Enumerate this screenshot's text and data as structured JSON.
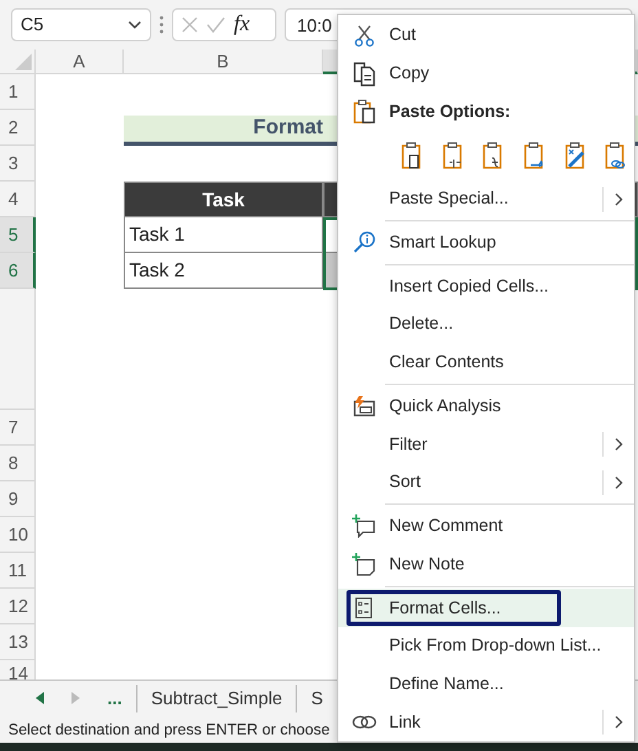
{
  "formula_bar": {
    "name_box": "C5",
    "function_label": "fx",
    "formula": "10:0"
  },
  "columns": [
    {
      "label": "A",
      "selected": false
    },
    {
      "label": "B",
      "selected": false
    },
    {
      "selected": true
    }
  ],
  "rows_upper": [
    {
      "number": "1",
      "selected": false
    },
    {
      "number": "2",
      "selected": false,
      "title": "Format"
    },
    {
      "number": "3",
      "selected": false
    },
    {
      "number": "4",
      "selected": false,
      "header": "Task"
    },
    {
      "number": "5",
      "selected": true,
      "cell_b": "Task 1"
    },
    {
      "number": "6",
      "selected": true,
      "cell_b": "Task 2"
    }
  ],
  "rows_lower": [
    {
      "number": "7"
    },
    {
      "number": "8"
    },
    {
      "number": "9"
    },
    {
      "number": "10"
    },
    {
      "number": "11"
    },
    {
      "number": "12"
    },
    {
      "number": "13"
    },
    {
      "number": "14"
    }
  ],
  "sheet_tabs": {
    "more": "...",
    "tabs": [
      {
        "label": "Subtract_Simple",
        "selected": false
      },
      {
        "label": "S",
        "selected": false
      }
    ]
  },
  "status_bar": "Select destination and press ENTER or choose",
  "menu": [
    {
      "kind": "item",
      "label": "Cut",
      "submenu": false,
      "selected": false
    },
    {
      "kind": "item",
      "label": "Copy",
      "submenu": false,
      "selected": false
    },
    {
      "kind": "heading",
      "label": "Paste Options:"
    },
    {
      "kind": "paste-icons"
    },
    {
      "kind": "item",
      "label": "Paste Special...",
      "submenu": true,
      "selected": false
    },
    {
      "kind": "separator"
    },
    {
      "kind": "item",
      "label": "Smart Lookup",
      "submenu": false,
      "selected": false
    },
    {
      "kind": "separator"
    },
    {
      "kind": "item",
      "label": "Insert Copied Cells...",
      "submenu": false,
      "selected": false
    },
    {
      "kind": "item",
      "label": "Delete...",
      "submenu": false,
      "selected": false
    },
    {
      "kind": "item",
      "label": "Clear Contents",
      "submenu": false,
      "selected": false
    },
    {
      "kind": "separator"
    },
    {
      "kind": "item",
      "label": "Quick Analysis",
      "submenu": false,
      "selected": false
    },
    {
      "kind": "item",
      "label": "Filter",
      "submenu": true,
      "selected": false
    },
    {
      "kind": "item",
      "label": "Sort",
      "submenu": true,
      "selected": false
    },
    {
      "kind": "separator"
    },
    {
      "kind": "item",
      "label": "New Comment",
      "submenu": false,
      "selected": false
    },
    {
      "kind": "item",
      "label": "New Note",
      "submenu": false,
      "selected": false
    },
    {
      "kind": "separator"
    },
    {
      "kind": "item",
      "label": "Format Cells...",
      "submenu": false,
      "selected": true
    },
    {
      "kind": "item",
      "label": "Pick From Drop-down List...",
      "submenu": false,
      "selected": false
    },
    {
      "kind": "item",
      "label": "Define Name...",
      "submenu": false,
      "selected": false
    },
    {
      "kind": "item",
      "label": "Link",
      "submenu": true,
      "selected": false
    }
  ]
}
